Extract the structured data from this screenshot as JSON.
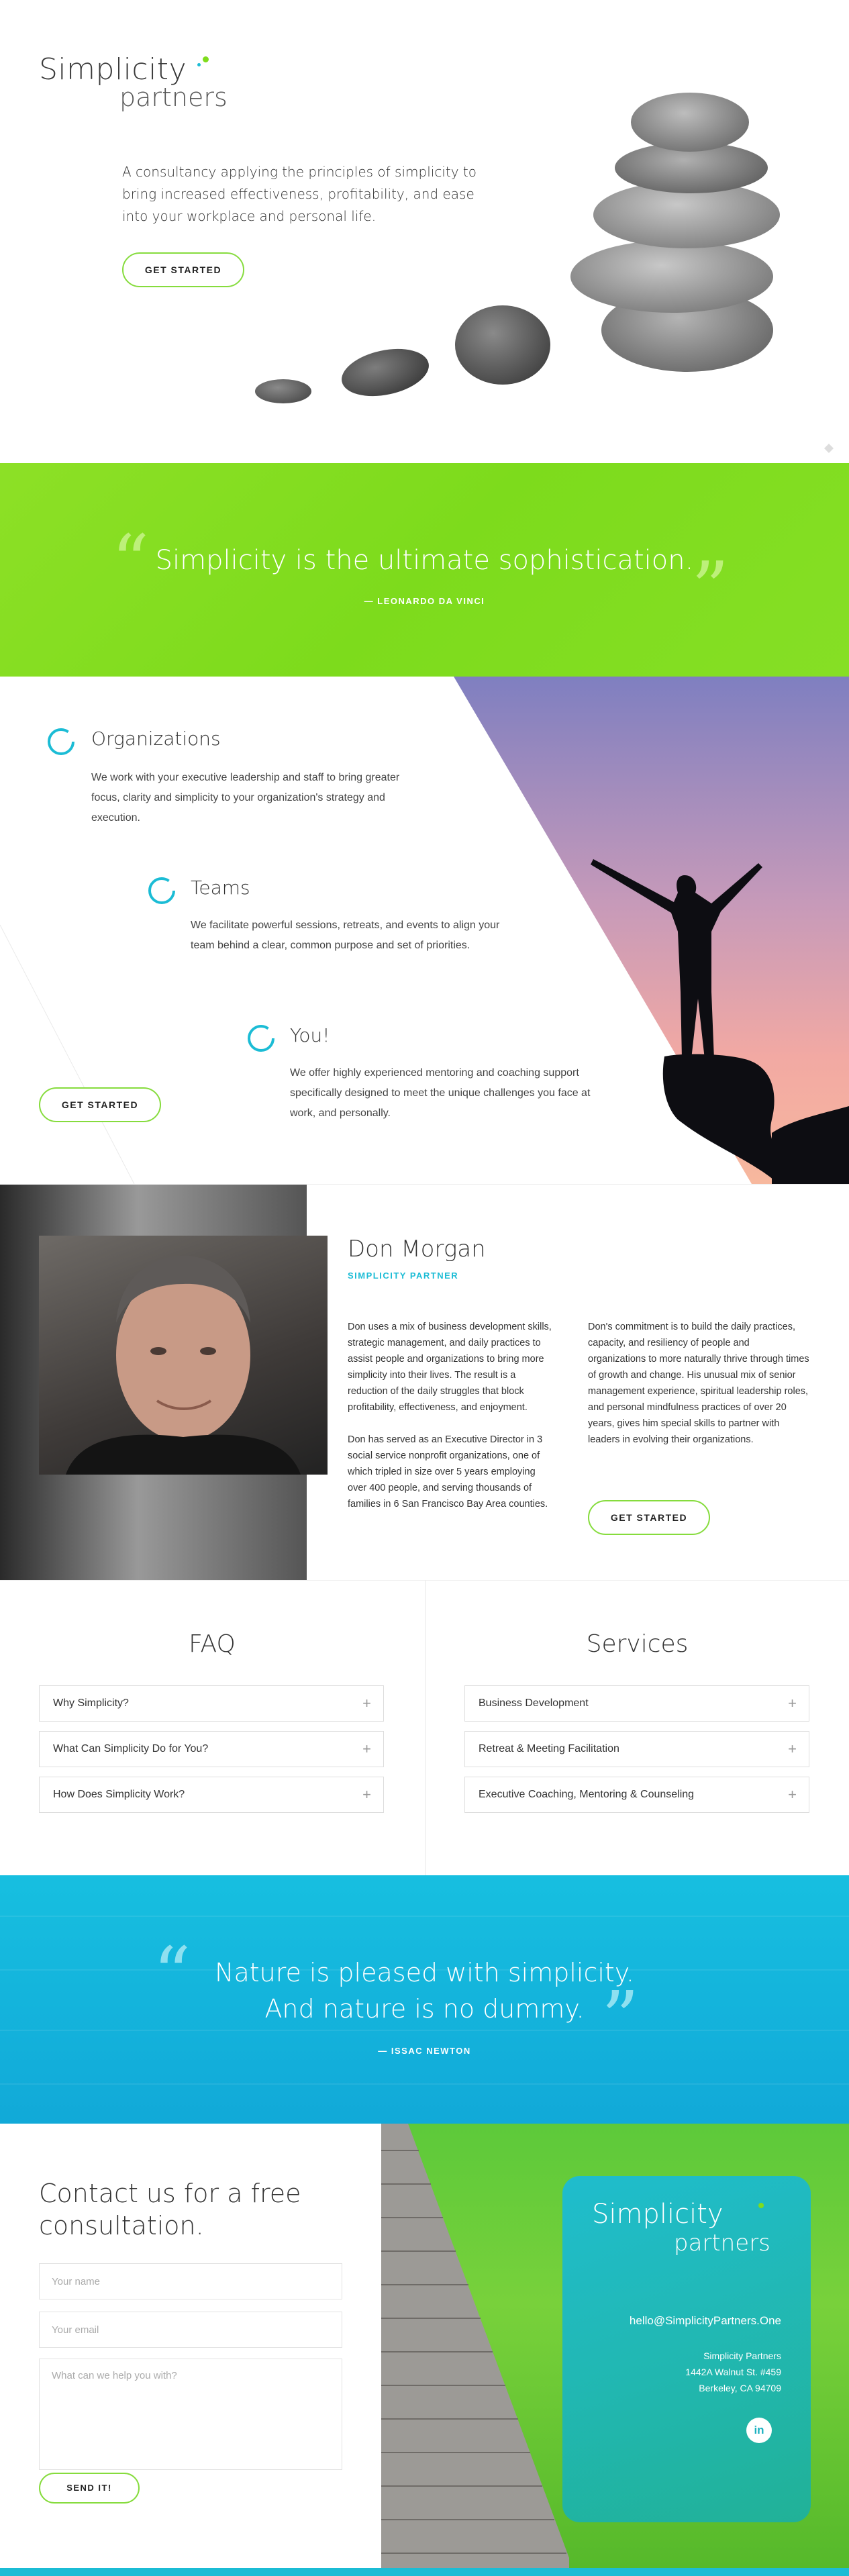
{
  "brand": {
    "line1": "Simplicity",
    "line2": "partners",
    "accent_green": "#7fdc1c",
    "accent_blue": "#1bbcd5"
  },
  "hero": {
    "tagline": "A consultancy applying the principles of simplicity to bring increased effectiveness, profitability, and ease into your workplace and personal life.",
    "cta": "GET STARTED"
  },
  "quote1": {
    "open": "“",
    "close": "”",
    "text": "Simplicity is the ultimate sophistication.",
    "author": "— LEONARDO DA VINCI"
  },
  "offerings": {
    "items": [
      {
        "title": "Organizations",
        "desc": "We work with your executive leadership and staff to bring greater focus, clarity and simplicity to your organization's strategy and execution."
      },
      {
        "title": "Teams",
        "desc": "We facilitate powerful sessions, retreats, and events to align your team behind a clear, common purpose and set of priorities."
      },
      {
        "title": "You!",
        "desc": "We offer highly experienced mentoring and coaching support specifically designed to meet the unique challenges you face at work, and personally."
      }
    ],
    "cta": "GET STARTED"
  },
  "bio": {
    "name": "Don Morgan",
    "role": "SIMPLICITY PARTNER",
    "col1_p1": "Don uses a mix of business development skills, strategic management, and daily practices to assist people and organizations to bring more simplicity into their lives. The result is a reduction of the daily struggles that block profitability, effectiveness, and enjoyment.",
    "col1_p2": "Don has served as an Executive Director in 3 social service nonprofit organizations, one of which tripled in size over 5 years employing over 400 people, and serving thousands of families in 6 San Francisco Bay Area counties.",
    "col2_p1": "Don's commitment is to build the daily practices, capacity, and resiliency of people and organizations to more naturally thrive through times of growth and change. His unusual mix of senior management experience, spiritual leadership roles, and personal mindfulness practices of over 20 years, gives him special skills to partner with leaders in evolving their organizations.",
    "cta": "GET STARTED"
  },
  "faq": {
    "title": "FAQ",
    "items": [
      "Why Simplicity?",
      "What Can Simplicity Do for You?",
      "How Does Simplicity Work?"
    ]
  },
  "services": {
    "title": "Services",
    "items": [
      "Business Development",
      "Retreat & Meeting Facilitation",
      "Executive Coaching, Mentoring & Counseling"
    ]
  },
  "quote2": {
    "open": "“",
    "close": "”",
    "line1": "Nature is pleased with simplicity.",
    "line2": "And nature is no dummy.",
    "author": "— ISSAC NEWTON"
  },
  "contact": {
    "title": "Contact us for a free consultation.",
    "name_placeholder": "Your name",
    "email_placeholder": "Your email",
    "message_placeholder": "What can we help you with?",
    "submit": "SEND IT!",
    "card_line1": "Simplicity",
    "card_line2": "partners",
    "email": "hello@SimplicityPartners.One",
    "addr1": "Simplicity Partners",
    "addr2": "1442A Walnut St. #459",
    "addr3": "Berkeley, CA 94709",
    "linkedin": "in"
  }
}
